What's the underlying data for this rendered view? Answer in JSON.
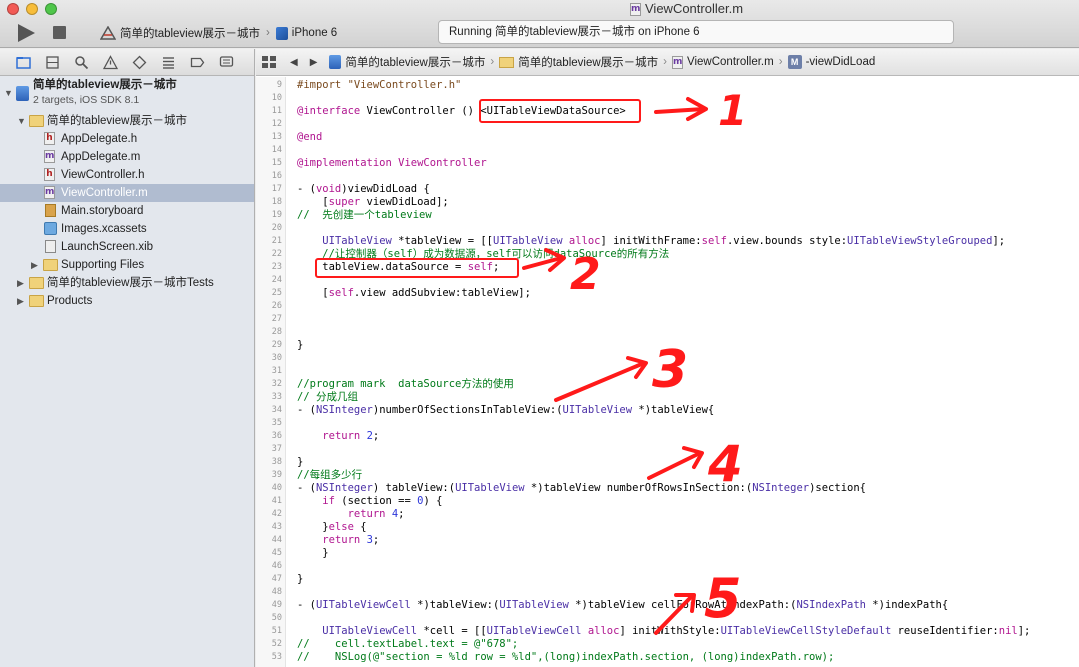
{
  "window": {
    "title": "ViewController.m",
    "scheme_target": "简单的tableview展示－城市",
    "scheme_device": "iPhone 6",
    "activity": "Running 简单的tableview展示－城市 on iPhone 6"
  },
  "navigator": {
    "tabs": [
      "project-navigator",
      "symbol-navigator",
      "find-navigator",
      "issue-navigator",
      "test-navigator",
      "debug-navigator",
      "breakpoint-navigator",
      "report-navigator"
    ],
    "project": {
      "name": "简单的tableview展示－城市",
      "subtitle": "2 targets, iOS SDK 8.1"
    },
    "items": [
      {
        "label": "简单的tableview展示－城市",
        "kind": "folder"
      },
      {
        "label": "AppDelegate.h",
        "kind": "h"
      },
      {
        "label": "AppDelegate.m",
        "kind": "m"
      },
      {
        "label": "ViewController.h",
        "kind": "h"
      },
      {
        "label": "ViewController.m",
        "kind": "m"
      },
      {
        "label": "Main.storyboard",
        "kind": "storyboard"
      },
      {
        "label": "Images.xcassets",
        "kind": "xcassets"
      },
      {
        "label": "LaunchScreen.xib",
        "kind": "xib"
      },
      {
        "label": "Supporting Files",
        "kind": "folder"
      },
      {
        "label": "简单的tableview展示－城市Tests",
        "kind": "folder"
      },
      {
        "label": "Products",
        "kind": "folder"
      }
    ]
  },
  "jumpbar": {
    "crumbs": [
      "简单的tableview展示－城市",
      "简单的tableview展示－城市",
      "ViewController.m",
      "-viewDidLoad"
    ],
    "method_badge": "M"
  },
  "editor": {
    "line_numbers": [
      "9",
      "10",
      "11",
      "12",
      "13",
      "14",
      "15",
      "16",
      "17",
      "18",
      "19",
      "20",
      "21",
      "22",
      "23",
      "24",
      "25",
      "26",
      "27",
      "28",
      "29",
      "30",
      "31",
      "32",
      "33",
      "34",
      "35",
      "36",
      "37",
      "38",
      "39",
      "40",
      "41",
      "42",
      "43",
      "44",
      "45",
      "46",
      "47",
      "48",
      "49",
      "50",
      "51",
      "52",
      "53"
    ],
    "lines": [
      "#import \"ViewController.h\"",
      "",
      "@interface ViewController () <UITableViewDataSource>",
      "",
      "@end",
      "",
      "@implementation ViewController",
      "",
      "- (void)viewDidLoad {",
      "    [super viewDidLoad];",
      "//  先创建一个tableview",
      "",
      "    UITableView *tableView = [[UITableView alloc] initWithFrame:self.view.bounds style:UITableViewStyleGrouped];",
      "    //让控制器（self）成为数据源，self可以访问dataSource的所有方法",
      "    tableView.dataSource = self;",
      "",
      "    [self.view addSubview:tableView];",
      "",
      "",
      "",
      "}",
      "",
      "",
      "//program mark  dataSource方法的使用",
      "// 分成几组",
      "- (NSInteger)numberOfSectionsInTableView:(UITableView *)tableView{",
      "",
      "    return 2;",
      "",
      "}",
      "//每组多少行",
      "- (NSInteger) tableView:(UITableView *)tableView numberOfRowsInSection:(NSInteger)section{",
      "    if (section == 0) {",
      "        return 4;",
      "    }else {",
      "    return 3;",
      "    }",
      "",
      "}",
      "",
      "- (UITableViewCell *)tableView:(UITableView *)tableView cellForRowAtIndexPath:(NSIndexPath *)indexPath{",
      "",
      "    UITableViewCell *cell = [[UITableViewCell alloc] initWithStyle:UITableViewCellStyleDefault reuseIdentifier:nil];",
      "//    cell.textLabel.text = @\"678\";",
      "//    NSLog(@\"section = %ld row = %ld\",(long)indexPath.section, (long)indexPath.row);"
    ],
    "line_kinds": [
      "pp",
      "",
      "code",
      "",
      "kw",
      "",
      "kw",
      "",
      "code",
      "code",
      "cmt",
      "",
      "code",
      "cmt",
      "code",
      "",
      "code",
      "",
      "",
      "",
      "code",
      "",
      "",
      "cmt",
      "cmt",
      "code",
      "",
      "code",
      "",
      "code",
      "cmt",
      "code",
      "code",
      "code",
      "code",
      "code",
      "code",
      "",
      "code",
      "",
      "code",
      "",
      "code",
      "cmt",
      "cmt"
    ]
  },
  "annotations": {
    "color": "#ff1a1a",
    "labels": [
      "1",
      "2",
      "3",
      "4",
      "5"
    ]
  }
}
